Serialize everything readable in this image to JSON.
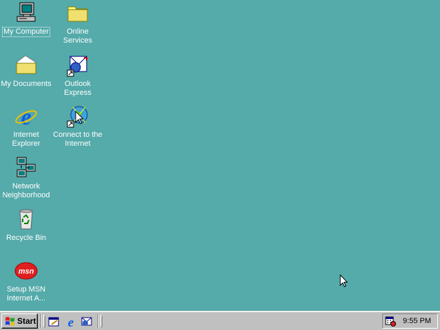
{
  "desktop": {
    "background_color": "#55aaaa",
    "icons": [
      {
        "name": "my-computer-icon",
        "label": "My Computer",
        "selected": true
      },
      {
        "name": "online-services-folder-icon",
        "label": "Online Services"
      },
      {
        "name": "my-documents-folder-icon",
        "label": "My Documents"
      },
      {
        "name": "outlook-express-icon",
        "label": "Outlook Express"
      },
      {
        "name": "internet-explorer-icon",
        "label": "Internet Explorer"
      },
      {
        "name": "connect-to-internet-icon",
        "label": "Connect to the Internet"
      },
      {
        "name": "network-neighborhood-icon",
        "label": "Network Neighborhood"
      },
      {
        "name": "recycle-bin-icon",
        "label": "Recycle Bin"
      },
      {
        "name": "msn-icon",
        "label": "Setup MSN Internet A..."
      }
    ]
  },
  "taskbar": {
    "start_label": "Start",
    "quick_launch": [
      "show-desktop-icon",
      "internet-explorer-icon",
      "outlook-express-icon"
    ],
    "tray_icons": [
      "scheduler-icon"
    ],
    "clock": "9:55 PM"
  }
}
